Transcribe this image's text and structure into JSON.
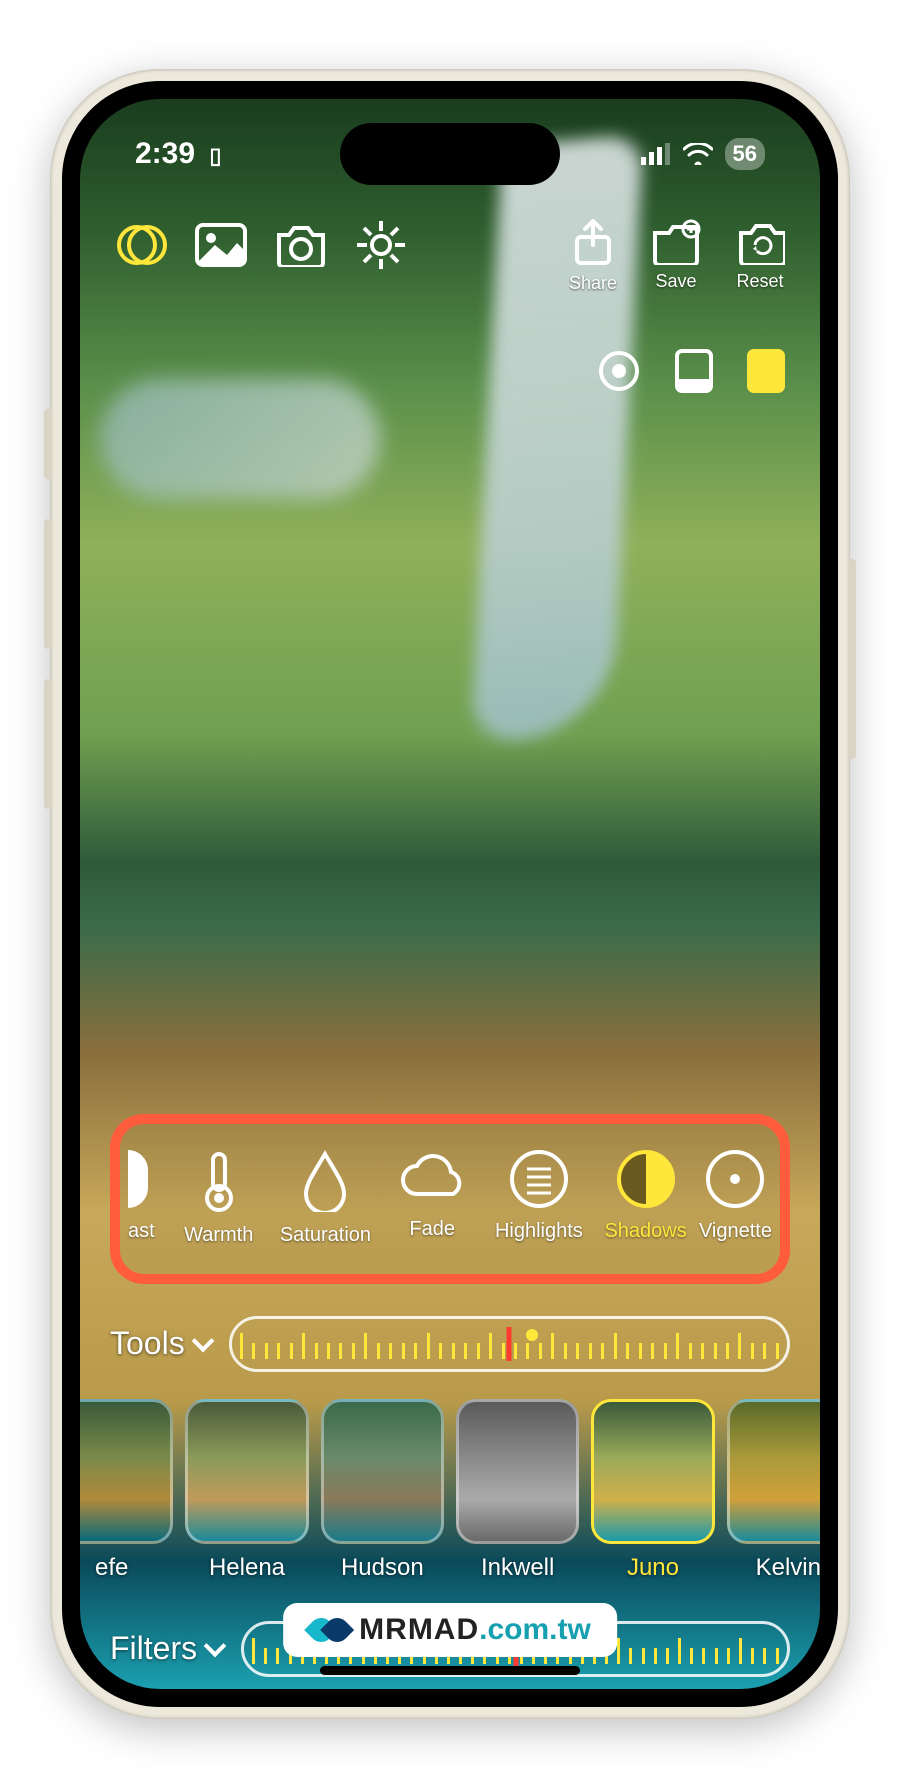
{
  "status": {
    "time": "2:39",
    "battery": "56"
  },
  "top_actions": {
    "share": "Share",
    "save": "Save",
    "reset": "Reset"
  },
  "adjustments": [
    {
      "key": "contrast",
      "label": "ast"
    },
    {
      "key": "warmth",
      "label": "Warmth"
    },
    {
      "key": "saturation",
      "label": "Saturation"
    },
    {
      "key": "fade",
      "label": "Fade"
    },
    {
      "key": "highlights",
      "label": "Highlights"
    },
    {
      "key": "shadows",
      "label": "Shadows",
      "active": true
    },
    {
      "key": "vignette",
      "label": "Vignette"
    }
  ],
  "tools_label": "Tools",
  "filters": [
    {
      "key": "hefe",
      "label": "efe"
    },
    {
      "key": "helena",
      "label": "Helena"
    },
    {
      "key": "hudson",
      "label": "Hudson"
    },
    {
      "key": "inkwell",
      "label": "Inkwell"
    },
    {
      "key": "juno",
      "label": "Juno",
      "active": true
    },
    {
      "key": "kelvin",
      "label": "Kelvin"
    }
  ],
  "filters_label": "Filters",
  "watermark": {
    "brand": "MRMAD",
    "suffix": ".com.tw"
  },
  "colors": {
    "accent": "#ffe63b",
    "highlight_box": "#ff5c3d"
  }
}
